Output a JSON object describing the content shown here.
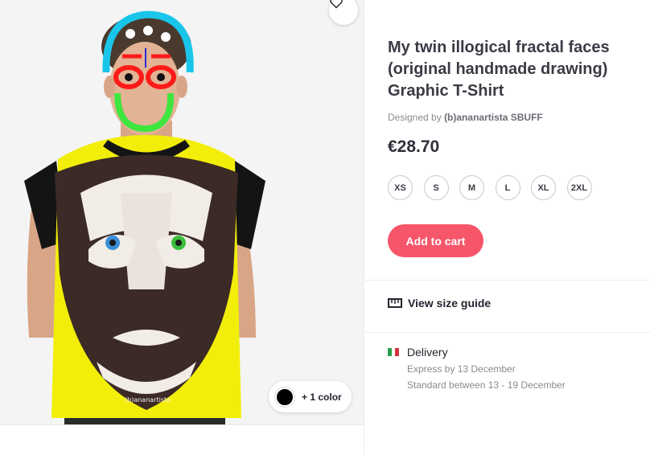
{
  "product": {
    "title": "My twin illogical fractal faces (original handmade drawing) Graphic T-Shirt",
    "designer_prefix": "Designed by",
    "designer_name": "(b)ananartista SBUFF",
    "price": "€28.70",
    "sizes": [
      "XS",
      "S",
      "M",
      "L",
      "XL",
      "2XL"
    ],
    "add_to_cart_label": "Add to cart",
    "color_count_label": "+ 1 color",
    "shirt_signature": "(b)ananartista"
  },
  "size_guide": {
    "label": "View size guide",
    "icon": "ruler-icon"
  },
  "delivery": {
    "heading": "Delivery",
    "flag": "italy-flag-icon",
    "express": "Express by 13 December",
    "standard": "Standard between 13 - 19 December"
  },
  "favorite": {
    "icon": "heart-icon"
  },
  "colors": {
    "accent": "#f6566a",
    "swatch": "#000000",
    "shirt_yellow": "#f2ee0a",
    "shirt_black": "#141414"
  }
}
